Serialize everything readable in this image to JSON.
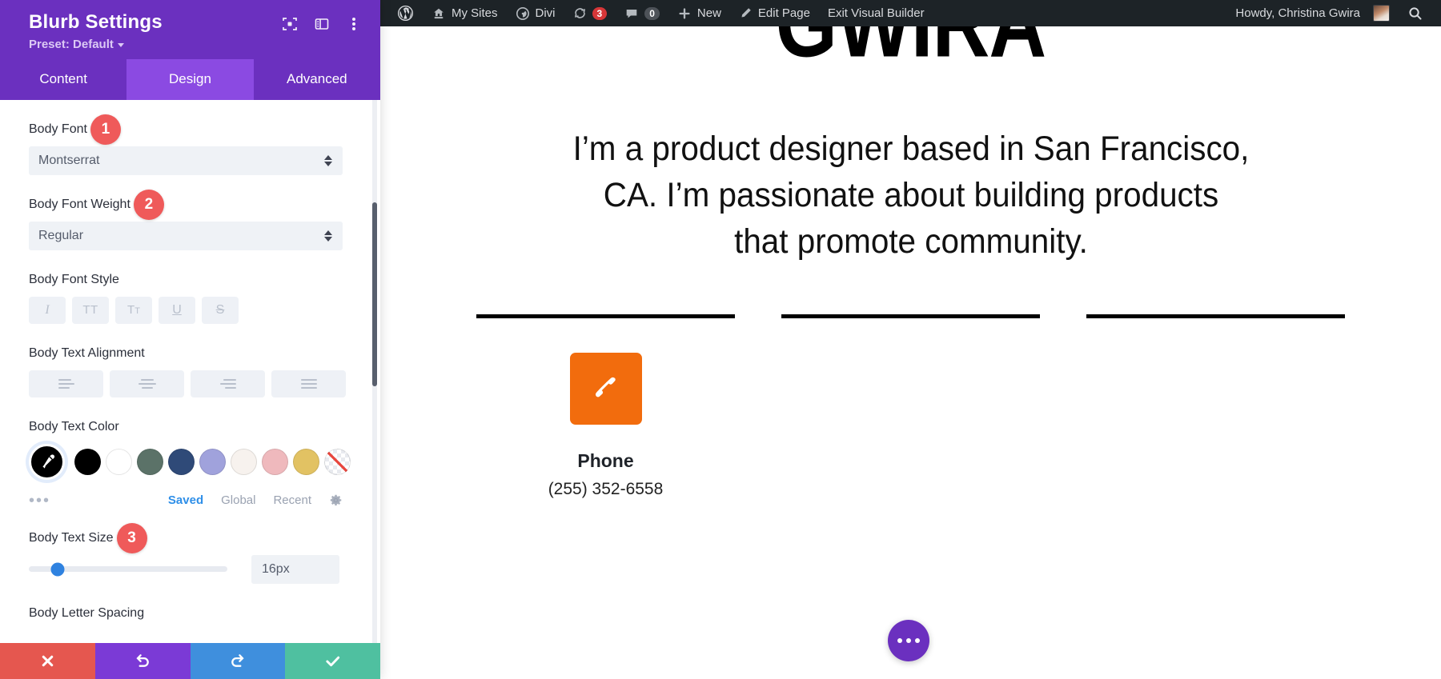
{
  "panel": {
    "title": "Blurb Settings",
    "preset_label": "Preset: Default",
    "header_icons": [
      {
        "name": "focus-target-icon"
      },
      {
        "name": "panel-layout-icon"
      },
      {
        "name": "vertical-dots-icon"
      }
    ],
    "tabs": [
      {
        "label": "Content",
        "active": false
      },
      {
        "label": "Design",
        "active": true
      },
      {
        "label": "Advanced",
        "active": false
      }
    ],
    "fields": {
      "body_font": {
        "label": "Body Font",
        "value": "Montserrat",
        "badge": "1"
      },
      "body_font_weight": {
        "label": "Body Font Weight",
        "value": "Regular",
        "badge": "2"
      },
      "body_font_style": {
        "label": "Body Font Style",
        "options": [
          "italic",
          "uppercase",
          "small-caps",
          "underline",
          "strikethrough"
        ]
      },
      "body_text_alignment": {
        "label": "Body Text Alignment",
        "options": [
          "align-left",
          "align-center",
          "align-right",
          "align-justify"
        ]
      },
      "body_text_color": {
        "label": "Body Text Color",
        "selected_swatch": "eyedropper",
        "swatches": [
          "#000000",
          "#ffffff",
          "#5b7268",
          "#2f4a78",
          "#a0a2dc",
          "#f7f2ee",
          "#efb9bd",
          "#e2c263",
          "transparent"
        ],
        "source_tabs": [
          {
            "label": "Saved",
            "active": true
          },
          {
            "label": "Global",
            "active": false
          },
          {
            "label": "Recent",
            "active": false
          }
        ],
        "more_label": "•••",
        "settings_icon": "gear-icon"
      },
      "body_text_size": {
        "label": "Body Text Size",
        "value": "16px",
        "badge": "3",
        "slider_percent": 14
      },
      "body_letter_spacing": {
        "label": "Body Letter Spacing"
      }
    },
    "footer": [
      {
        "name": "cancel-button",
        "icon": "close-icon"
      },
      {
        "name": "undo-button",
        "icon": "undo-icon"
      },
      {
        "name": "redo-button",
        "icon": "redo-icon"
      },
      {
        "name": "save-button",
        "icon": "check-icon"
      }
    ],
    "colors": {
      "header": "#6b30bf",
      "tab_active": "#8b4ae2",
      "badge": "#ef5a5a",
      "accent_blue": "#2f8fe8"
    }
  },
  "adminbar": {
    "items": [
      {
        "label": "",
        "icon": "wordpress-logo-icon"
      },
      {
        "label": "My Sites",
        "icon": "sites-icon"
      },
      {
        "label": "Divi",
        "icon": "divi-gauge-icon"
      },
      {
        "label": "3",
        "icon": "updates-icon"
      },
      {
        "label": "0",
        "icon": "comment-icon"
      },
      {
        "label": "New",
        "icon": "plus-icon"
      },
      {
        "label": "Edit Page",
        "icon": "pencil-icon"
      },
      {
        "label": "Exit Visual Builder",
        "icon": ""
      }
    ],
    "greeting": "Howdy, Christina Gwira",
    "search_icon": "search-icon"
  },
  "site": {
    "hero_word": "GWIRA",
    "tagline": "I’m a product designer based in San Francisco, CA. I’m passionate about building products that promote community.",
    "blurbs": [
      {
        "icon": "phone-icon",
        "title": "Phone",
        "text": "(255) 352-6558",
        "icon_color": "#f26c0d"
      },
      {
        "icon": "",
        "title": "",
        "text": ""
      },
      {
        "icon": "",
        "title": "",
        "text": ""
      }
    ],
    "fab_icon": "horizontal-dots-icon"
  }
}
